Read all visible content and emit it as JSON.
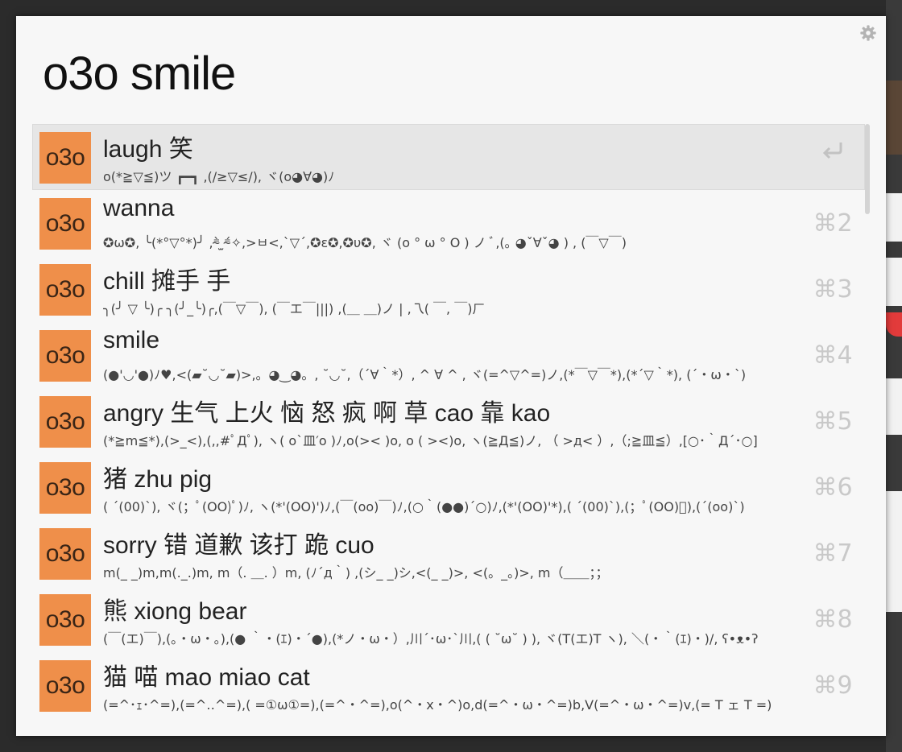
{
  "search": {
    "query": "o3o smile"
  },
  "icons": {
    "settings": "gear-icon",
    "return": "return-key-icon"
  },
  "colors": {
    "icon_bg": "#ef8f4a",
    "selected_bg": "#e6e6e6",
    "shortcut": "#c9c9c9"
  },
  "results": [
    {
      "icon_text": "o3o",
      "title": "laugh 笑",
      "subtitle": "o(*≧▽≦)ツ ┏━┓ ,(/≥▽≤/), ヾ(o◕∀◕)ﾉ",
      "shortcut": ""
    },
    {
      "icon_text": "o3o",
      "title": "wanna",
      "subtitle": "✪ω✪, ╰(*°▽°*)╯ ,⁼̴̀ ̫⁼̴́✧,>ㅂ<,`▽´,✪ε✪,✪υ✪, ヾ (o ° ω ° O ) ノ ﾞ,(｡ ◕ˇ∀ˇ◕ ) , (￣▽￣)",
      "shortcut": "⌘2"
    },
    {
      "icon_text": "o3o",
      "title": "chill 摊手 手",
      "subtitle": "╮(╯ ▽ ╰)╭ ╮(╯_╰)╭,(￣▽￣), (￣エ￣|||) ,(＿ ＿)ノ | ,乁( ￣, ￣)ㄏ",
      "shortcut": "⌘3"
    },
    {
      "icon_text": "o3o",
      "title": "smile",
      "subtitle": "(●'◡'●)ﾉ♥,<(▰˘◡˘▰)>,。◕‿◕。, ˘◡˘,（´∀｀*）, ^ ∀ ^ , ヾ(=^▽^=)ノ,(*￣▽￣*),(*´▽｀*), (´・ω・`)",
      "shortcut": "⌘4"
    },
    {
      "icon_text": "o3o",
      "title": "angry 生气 上火 恼 怒 疯 啊 草 cao 靠 kao",
      "subtitle": "(*≧m≦*),(>_<),(,,#ﾟДﾟ), ヽ( o`皿′o )ﾉ,o(>< )o, o ( ><)o, ヽ(≧Д≦)ノ, （ >д< ）,（;≧皿≦）,[○･｀Д´･○]",
      "shortcut": "⌘5"
    },
    {
      "icon_text": "o3o",
      "title": "猪 zhu pig",
      "subtitle": "( ´(00)ˋ), ヾ(；ﾟ(OO)ﾟ)ﾉ, ヽ(*'(OO)')ﾉ,(￣(oo)￣)ﾉ,(○｀(●●)´○)ﾉ,(*'(OO)'*),( ´(00)ˋ),(；ﾟ(OO)ﾟ),(´(oo)`)",
      "shortcut": "⌘6"
    },
    {
      "icon_text": "o3o",
      "title": "sorry 错 道歉 该打 跪 cuo",
      "subtitle": "m(_ _)m,m(._.)m, m（. ＿. ）m, (ﾉ´д｀) ,(シ_ _)シ,<(_ _)>, <(。_。)>, m（＿＿；；",
      "shortcut": "⌘7"
    },
    {
      "icon_text": "o3o",
      "title": "熊 xiong bear",
      "subtitle": "(￣(エ)￣),(｡・ω・｡),(● ｀・(ｴ)・´●),(*ノ・ω・）,川´･ω･`川,( ( ˘ω˘ ) ), ヾ(T(エ)T ヽ), ＼(・｀(ｴ)・)/, ʕ•ᴥ•ʔ",
      "shortcut": "⌘8"
    },
    {
      "icon_text": "o3o",
      "title": "猫 喵 mao miao cat",
      "subtitle": "(=^･ｪ･^=),(=^‥^=),( =①ω①=),(=^・^=),o(^・x・^)o,d(=^・ω・^=)b,V(=^・ω・^=)v,(= T ェ T =)",
      "shortcut": "⌘9"
    }
  ]
}
